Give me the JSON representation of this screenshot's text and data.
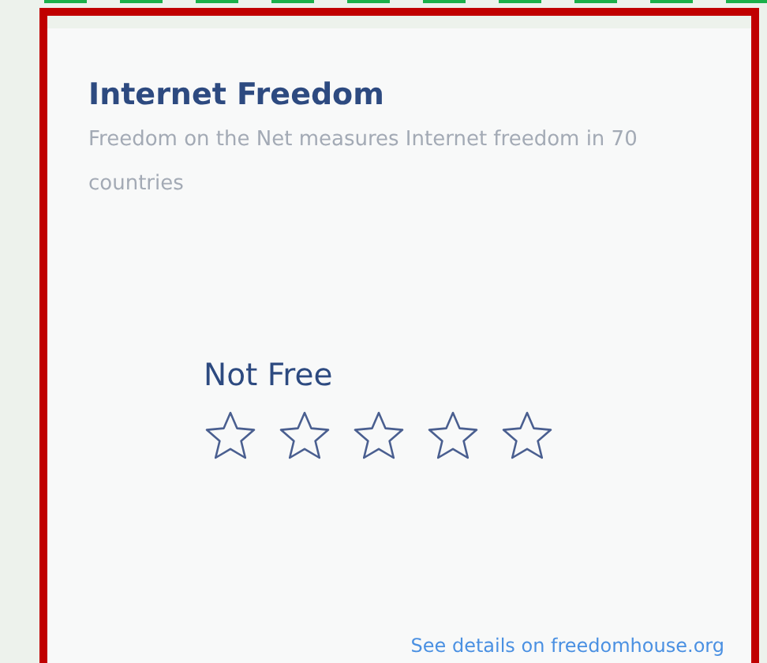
{
  "card": {
    "title": "Internet Freedom",
    "description": "Freedom on the Net measures Internet freedom in 70 countries",
    "status": "Not Free",
    "stars": 0,
    "link": "See details on freedomhouse.org"
  }
}
